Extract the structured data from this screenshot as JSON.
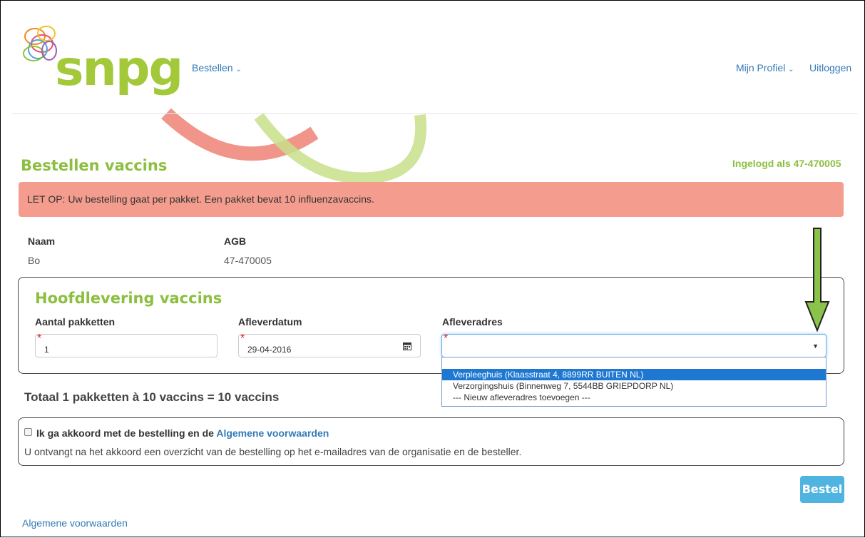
{
  "logo": {
    "text": "snpg"
  },
  "nav": {
    "bestellen": "Bestellen",
    "profiel": "Mijn Profiel",
    "uitloggen": "Uitloggen"
  },
  "page": {
    "title": "Bestellen vaccins",
    "logged_in": "Ingelogd als 47-470005"
  },
  "alert": "LET OP: Uw bestelling gaat per pakket. Een pakket bevat 10 influenzavaccins.",
  "info": {
    "naam_label": "Naam",
    "naam_value": "Bo",
    "agb_label": "AGB",
    "agb_value": "47-470005"
  },
  "delivery": {
    "title": "Hoofdlevering vaccins",
    "aantal_label": "Aantal pakketten",
    "aantal_value": "1",
    "datum_label": "Afleverdatum",
    "datum_value": "29-04-2016",
    "adres_label": "Afleveradres",
    "adres_value": "",
    "options": [
      "Verpleeghuis (Klaasstraat 4, 8899RR BUITEN NL)",
      "Verzorgingshuis (Binnenweg 7, 5544BB GRIEPDORP NL)",
      "--- Nieuw afleveradres toevoegen ---"
    ],
    "selected_index": 0
  },
  "totaal": "Totaal 1 pakketten à 10 vaccins = 10 vaccins",
  "agreement": {
    "label": "Ik ga akkoord met de bestelling en de",
    "link": "Algemene voorwaarden",
    "note": "U ontvangt na het akkoord een overzicht van de bestelling op het e-mailadres van de organisatie en de besteller.",
    "checked": false
  },
  "bestel_button": "Bestel",
  "footer_link": "Algemene voorwaarden",
  "colors": {
    "brand_green": "#a3c93a",
    "title_green": "#8cbf3f",
    "alert_bg": "#f49d8e",
    "link_blue": "#337ab7",
    "button_blue": "#4fb4e0",
    "arrow_green": "#8bc34a"
  }
}
